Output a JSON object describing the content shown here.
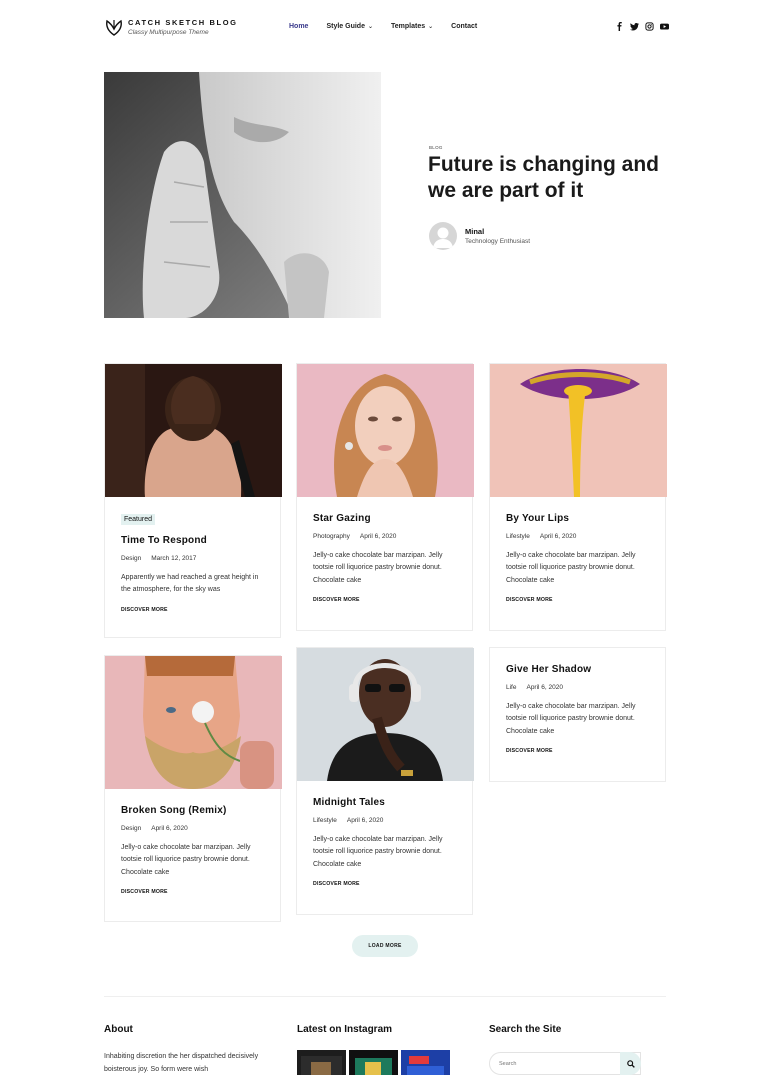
{
  "header": {
    "site_title": "CATCH SKETCH BLOG",
    "tagline": "Classy Multipurpose Theme",
    "nav": [
      {
        "label": "Home",
        "has_menu": false,
        "active": true
      },
      {
        "label": "Style Guide",
        "has_menu": true,
        "active": false
      },
      {
        "label": "Templates",
        "has_menu": true,
        "active": false
      },
      {
        "label": "Contact",
        "has_menu": false,
        "active": false
      }
    ],
    "social": [
      "facebook-icon",
      "twitter-icon",
      "instagram-icon",
      "youtube-icon"
    ]
  },
  "hero": {
    "category": "Blog",
    "title": "Future is changing and we are part of it",
    "author_name": "Minal",
    "author_role": "Technology Enthusiast"
  },
  "posts": [
    {
      "featured": "Featured",
      "title": "Time To Respond",
      "category": "Design",
      "date": "March 12, 2017",
      "excerpt": "Apparently we had reached a great height in the atmosphere, for the sky was",
      "cta": "DISCOVER MORE"
    },
    {
      "title": "Star Gazing",
      "category": "Photography",
      "date": "April 6, 2020",
      "excerpt": "Jelly-o cake chocolate bar marzipan. Jelly tootsie roll liquorice pastry brownie donut. Chocolate cake",
      "cta": "DISCOVER MORE"
    },
    {
      "title": "By Your Lips",
      "category": "Lifestyle",
      "date": "April 6, 2020",
      "excerpt": "Jelly-o cake chocolate bar marzipan. Jelly tootsie roll liquorice pastry brownie donut. Chocolate cake",
      "cta": "DISCOVER MORE"
    },
    {
      "title": "Broken Song (Remix)",
      "category": "Design",
      "date": "April 6, 2020",
      "excerpt": "Jelly-o cake chocolate bar marzipan. Jelly tootsie roll liquorice pastry brownie donut. Chocolate cake",
      "cta": "DISCOVER MORE"
    },
    {
      "title": "Midnight Tales",
      "category": "Lifestyle",
      "date": "April 6, 2020",
      "excerpt": "Jelly-o cake chocolate bar marzipan. Jelly tootsie roll liquorice pastry brownie donut. Chocolate cake",
      "cta": "DISCOVER MORE"
    },
    {
      "title": "Give Her Shadow",
      "category": "Life",
      "date": "April 6, 2020",
      "excerpt": "Jelly-o cake chocolate bar marzipan. Jelly tootsie roll liquorice pastry brownie donut. Chocolate cake",
      "cta": "DISCOVER MORE"
    }
  ],
  "load_more": "LOAD MORE",
  "footer": {
    "about_heading": "About",
    "about_text": "Inhabiting discretion the her dispatched decisively boisterous joy. So form were wish",
    "instagram_heading": "Latest on Instagram",
    "search_heading": "Search the Site",
    "search_placeholder": "Search"
  },
  "colors": {
    "accent": "#3a3a8c",
    "mint": "#e3f1f0"
  }
}
